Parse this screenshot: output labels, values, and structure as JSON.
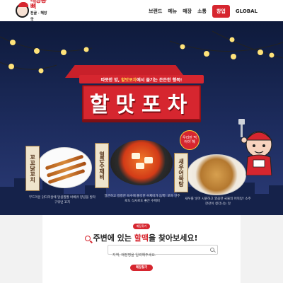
{
  "header": {
    "logo": {
      "title": "대왕통뼈",
      "subtitle": "전골 · 해장국",
      "name": "logo"
    },
    "nav": [
      {
        "label": "브랜드"
      },
      {
        "label": "메뉴"
      },
      {
        "label": "매장"
      },
      {
        "label": "소통"
      },
      {
        "label": "창업"
      },
      {
        "label": "GLOBAL"
      }
    ]
  },
  "banner": {
    "tagline_pre": "따뜻한 밤, ",
    "tagline_highlight": "할맛포차",
    "tagline_post": "에서 즐기는 든든한 행복!",
    "title": "할맛포차",
    "badge": "우리만 먹어야 해",
    "menus": [
      {
        "tag": "꼬꼬닭꼬치",
        "description": "부드러운 닭다리살에 달콤짭짤 바베큐 양념을 발라 구워낸 꼬치"
      },
      {
        "tag": "얼큰수제비",
        "description": "얼큰하고 칼칼한 육수에 쫄깃한 수제비가 듬뿍! 포차 안주로도 식사로도 좋은 수제비"
      },
      {
        "tag": "새우어묵탕",
        "description": "새우를 넣어 시원하고 깔끔한 국물의 어묵탕! 소주 한잔이 생각나는 맛"
      }
    ],
    "colors": {
      "night": "#0e1a3b",
      "accent": "#d6262f",
      "highlight": "#ffd84a"
    }
  },
  "store_search": {
    "pill": "매장찾기",
    "heading_pre": "주변에 있는 ",
    "heading_highlight": "할맥",
    "heading_post": "을 찾아보세요!",
    "placeholder": "지역, 매장명을 입력해주세요.",
    "button_label": "매장찾기"
  }
}
